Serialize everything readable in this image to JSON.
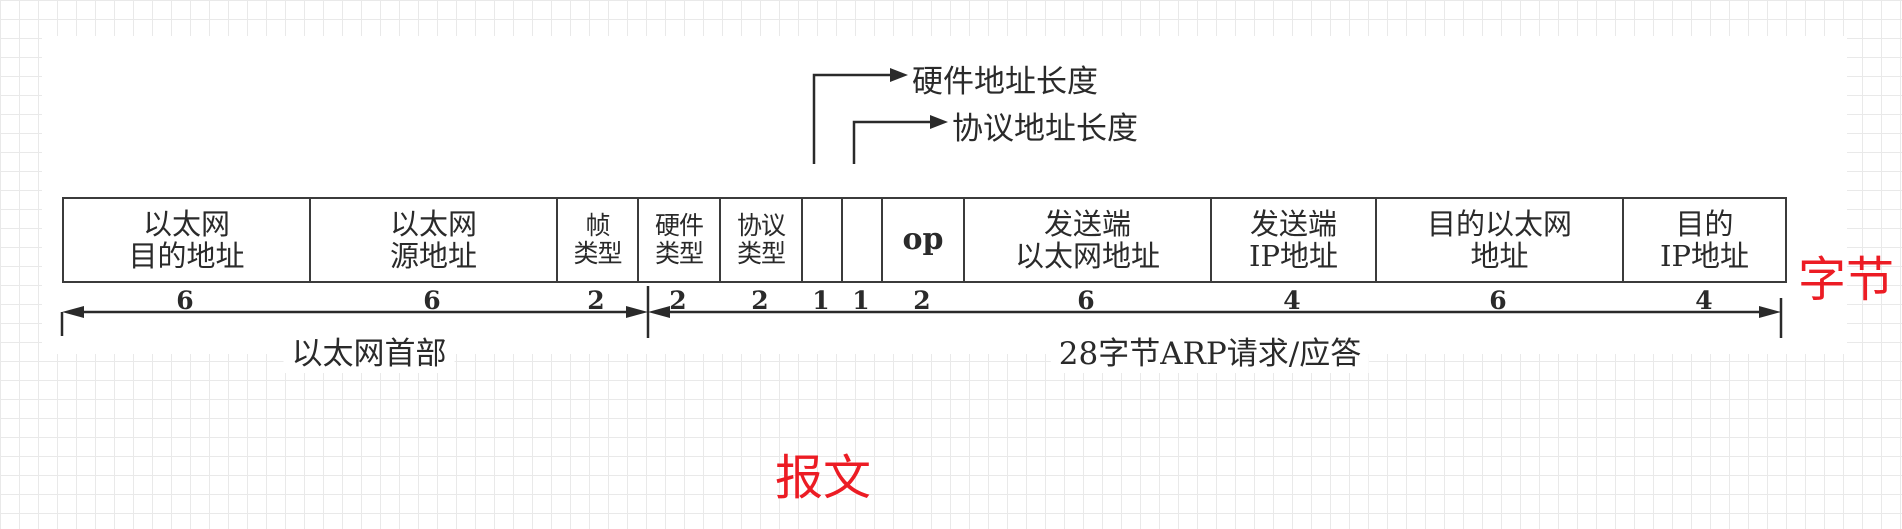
{
  "fields": [
    {
      "label": "以太网\n目的地址",
      "size": "6"
    },
    {
      "label": "以太网\n源地址",
      "size": "6"
    },
    {
      "label": "帧\n类型",
      "size": "2"
    },
    {
      "label": "硬件\n类型",
      "size": "2"
    },
    {
      "label": "协议\n类型",
      "size": "2"
    },
    {
      "label": "",
      "size": "1"
    },
    {
      "label": "",
      "size": "1"
    },
    {
      "label": "op",
      "size": "2"
    },
    {
      "label": "发送端\n以太网地址",
      "size": "6"
    },
    {
      "label": "发送端\nIP地址",
      "size": "4"
    },
    {
      "label": "目的以太网\n地址",
      "size": "6"
    },
    {
      "label": "目的\nIP地址",
      "size": "4"
    }
  ],
  "callouts": {
    "hw_addr_len": "硬件地址长度",
    "proto_addr_len": "协议地址长度"
  },
  "spans": {
    "ethernet_header": "以太网首部",
    "arp_body": "28字节ARP请求/应答"
  },
  "annotations": {
    "bytes": "字节",
    "message": "报文"
  }
}
